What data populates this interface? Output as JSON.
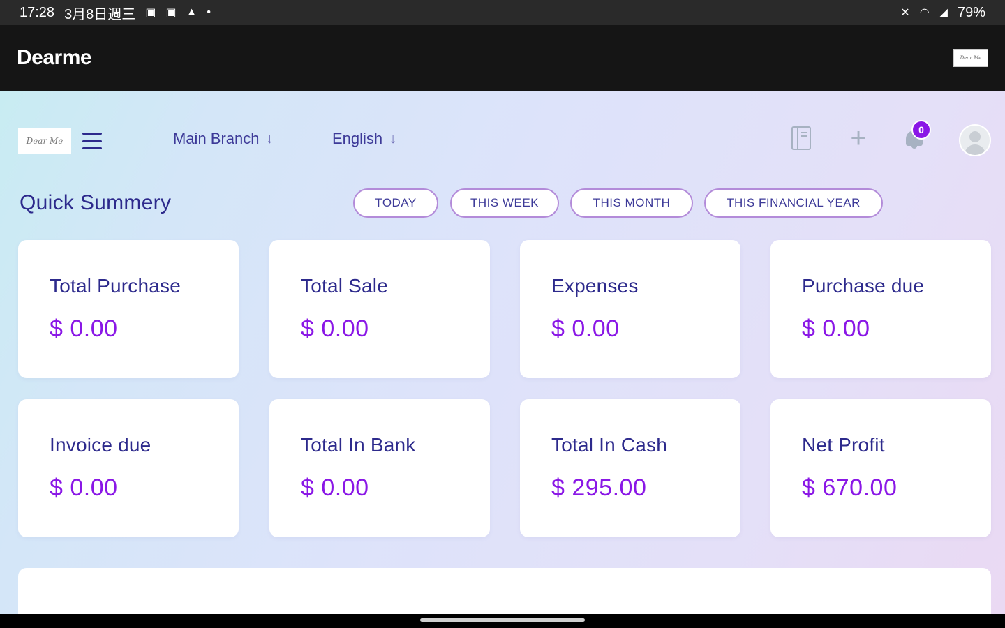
{
  "status_bar": {
    "time": "17:28",
    "date": "3月8日週三",
    "battery": "79%",
    "icons": [
      "image-icon",
      "image-icon",
      "warning-icon",
      "dot-icon",
      "mute-icon",
      "wifi-icon",
      "signal-icon",
      "battery-icon"
    ]
  },
  "app_bar": {
    "title": "Dearme"
  },
  "topnav": {
    "logo_text": "Dear Me",
    "branch": "Main Branch",
    "language": "English",
    "notification_count": "0"
  },
  "summary": {
    "title": "Quick Summery",
    "filters": [
      "TODAY",
      "THIS WEEK",
      "THIS MONTH",
      "THIS FINANCIAL YEAR"
    ],
    "cards": [
      {
        "label": "Total Purchase",
        "value": "$ 0.00"
      },
      {
        "label": "Total Sale",
        "value": "$ 0.00"
      },
      {
        "label": "Expenses",
        "value": "$ 0.00"
      },
      {
        "label": "Purchase due",
        "value": "$ 0.00"
      },
      {
        "label": "Invoice due",
        "value": "$ 0.00"
      },
      {
        "label": "Total In Bank",
        "value": "$ 0.00"
      },
      {
        "label": "Total In Cash",
        "value": "$ 295.00"
      },
      {
        "label": "Net Profit",
        "value": "$ 670.00"
      }
    ]
  },
  "colors": {
    "primary_text": "#2d2a8c",
    "accent": "#8a17e6",
    "pill_border": "#b38bd9",
    "app_bar_bg": "#151515"
  }
}
